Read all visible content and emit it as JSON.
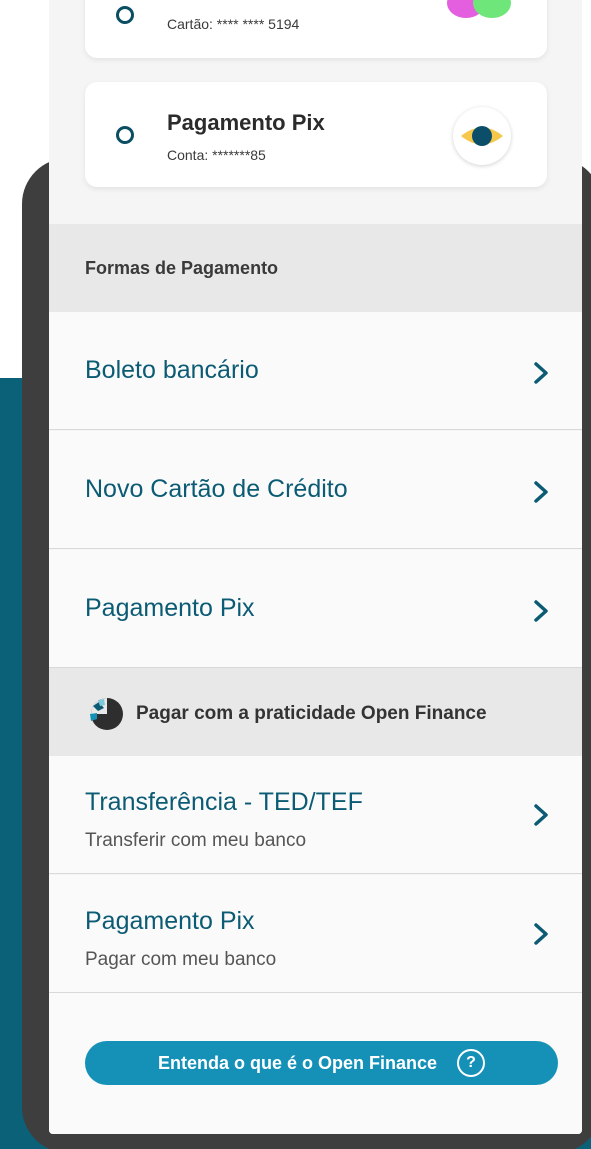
{
  "saved_methods": [
    {
      "title": "",
      "subtitle": "Cartão: **** **** 5194",
      "icon": "mastercard-icon"
    },
    {
      "title": "Pagamento Pix",
      "subtitle": "Conta: *******85",
      "icon": "pix-icon"
    }
  ],
  "payment_section": {
    "title": "Formas de Pagamento",
    "items": [
      {
        "label": "Boleto bancário"
      },
      {
        "label": "Novo Cartão de Crédito"
      },
      {
        "label": "Pagamento Pix"
      }
    ]
  },
  "open_finance_section": {
    "title": "Pagar com a praticidade Open Finance",
    "items": [
      {
        "label": "Transferência - TED/TEF",
        "sublabel": "Transferir com meu banco"
      },
      {
        "label": "Pagamento Pix",
        "sublabel": "Pagar com meu banco"
      }
    ]
  },
  "footer": {
    "button_label": "Entenda o que é o Open Finance",
    "help_glyph": "?"
  },
  "colors": {
    "accent_teal": "#0b6178",
    "link_blue": "#0c5b74",
    "button_blue": "#1591b8"
  }
}
